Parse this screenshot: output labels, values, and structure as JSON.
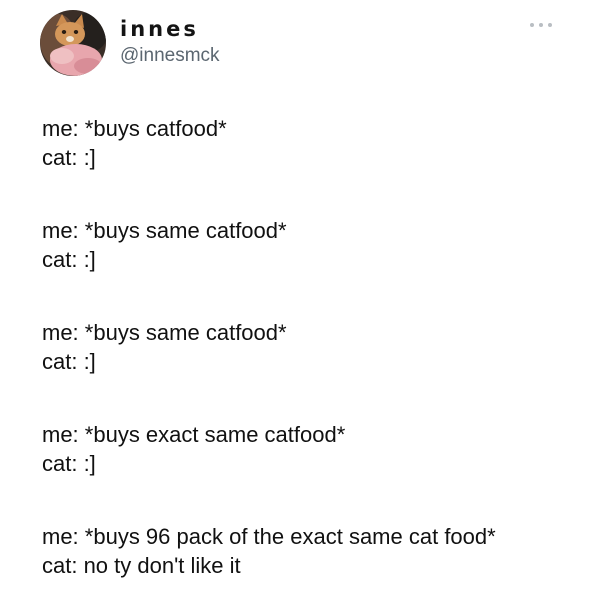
{
  "tweet": {
    "author": {
      "display_name": "innes",
      "handle": "@innesmck",
      "avatar_icon": "cat-avatar-icon"
    },
    "more_icon": "more-options-icon",
    "stanzas": [
      {
        "me": "me: *buys catfood*",
        "cat": "cat: :]"
      },
      {
        "me": "me: *buys same catfood*",
        "cat": "cat: :]"
      },
      {
        "me": "me: *buys same catfood*",
        "cat": "cat: :]"
      },
      {
        "me": "me: *buys exact same catfood*",
        "cat": "cat: :]"
      },
      {
        "me": "me: *buys 96 pack of the exact same cat food*",
        "cat": "cat: no ty don't like it"
      }
    ]
  },
  "colors": {
    "background": "#ffffff",
    "text": "#111111",
    "handle": "#5b6670",
    "more_dots": "#b9bec3"
  }
}
